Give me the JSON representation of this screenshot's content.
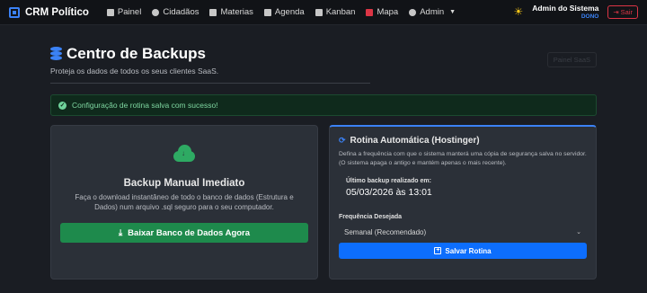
{
  "navbar": {
    "brand": "CRM Político",
    "items": [
      {
        "label": "Painel",
        "icon": "grid-icon"
      },
      {
        "label": "Cidadãos",
        "icon": "people-icon"
      },
      {
        "label": "Materias",
        "icon": "document-icon"
      },
      {
        "label": "Agenda",
        "icon": "calendar-icon"
      },
      {
        "label": "Kanban",
        "icon": "kanban-icon"
      },
      {
        "label": "Mapa",
        "icon": "map-icon"
      },
      {
        "label": "Admin",
        "icon": "shield-icon"
      }
    ],
    "user_name": "Admin do Sistema",
    "user_role": "DONO",
    "logout_label": "Sair"
  },
  "header": {
    "title": "Centro de Backups",
    "subtitle": "Proteja os dados de todos os seus clientes SaaS.",
    "ghost_button": "Painel SaaS"
  },
  "alert": {
    "message": "Configuração de rotina salva com sucesso!"
  },
  "manual": {
    "title": "Backup Manual Imediato",
    "description": "Faça o download instantâneo de todo o banco de dados (Estrutura e Dados) num arquivo .sql seguro para o seu computador.",
    "button": "Baixar Banco de Dados Agora"
  },
  "routine": {
    "title": "Rotina Automática (Hostinger)",
    "description": "Defina a frequência com que o sistema manterá uma cópia de segurança salva no servidor. (O sistema apaga o antigo e mantém apenas o mais recente).",
    "last_label": "Último backup realizado em:",
    "last_value": "05/03/2026 às 13:01",
    "freq_label": "Frequência Desejada",
    "freq_value": "Semanal (Recomendado)",
    "save_button": "Salvar Rotina"
  },
  "colors": {
    "accent": "#3b82f6",
    "success": "#1e8a4c",
    "danger": "#dc3545",
    "primary_button": "#0d6efd"
  }
}
